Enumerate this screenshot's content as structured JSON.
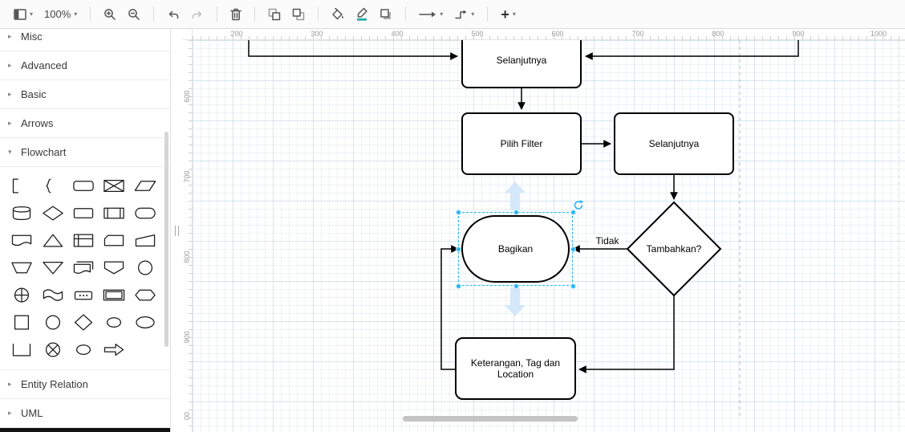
{
  "toolbar": {
    "zoom_value": "100%"
  },
  "sidebar": {
    "sections": [
      {
        "label": "Misc"
      },
      {
        "label": "Advanced"
      },
      {
        "label": "Basic"
      },
      {
        "label": "Arrows"
      },
      {
        "label": "Flowchart"
      },
      {
        "label": "Entity Relation"
      },
      {
        "label": "UML"
      }
    ]
  },
  "rulers": {
    "horizontal": [
      "200",
      "300",
      "400",
      "500",
      "600",
      "700",
      "800",
      "900",
      "1000"
    ],
    "vertical": [
      "600",
      "700",
      "800",
      "900",
      "00"
    ]
  },
  "canvas": {
    "nodes": {
      "top": {
        "label": "Selanjutnya"
      },
      "pilih_filter": {
        "label": "Pilih Filter"
      },
      "selanjutnya_right": {
        "label": "Selanjutnya"
      },
      "tambahkan": {
        "label": "Tambahkan?"
      },
      "bagikan": {
        "label": "Bagikan"
      },
      "keterangan": {
        "label": "Keterangan, Tag dan Location"
      }
    },
    "edge_labels": {
      "tidak": "Tidak"
    }
  }
}
